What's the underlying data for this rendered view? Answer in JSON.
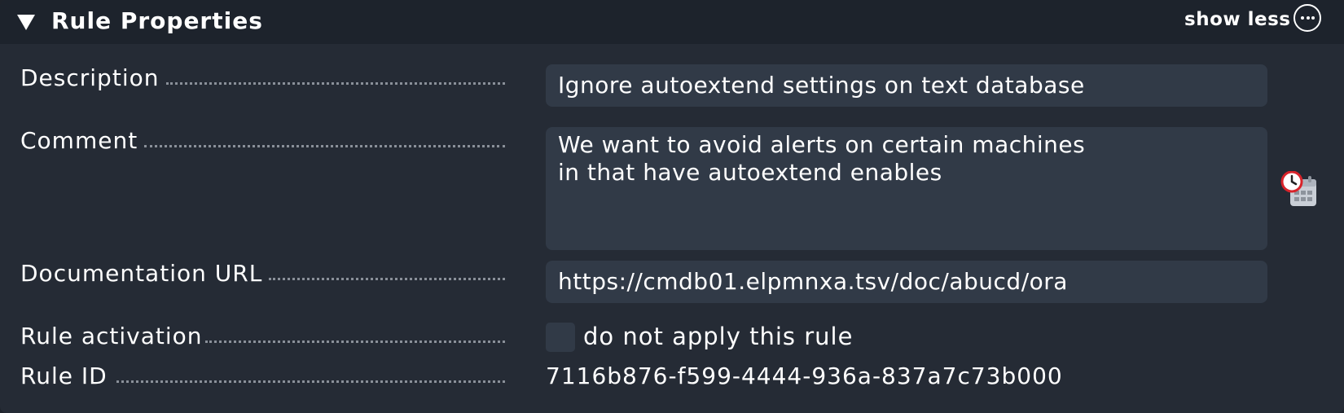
{
  "header": {
    "title": "Rule Properties",
    "show_less_label": "show less",
    "more_icon": "ellipsis-circle-icon"
  },
  "rows": {
    "description": {
      "label": "Description",
      "value": "Ignore autoextend settings on text database"
    },
    "comment": {
      "label": "Comment",
      "value": "We want to avoid alerts on certain machines\nin that have autoextend enables",
      "side_icon": "clock-calendar-icon"
    },
    "documentation_url": {
      "label": "Documentation URL",
      "value": "https://cmdb01.elpmnxa.tsv/doc/abucd/ora"
    },
    "rule_activation": {
      "label": "Rule activation",
      "checkbox_label": "do not apply this rule",
      "checked": false
    },
    "rule_id": {
      "label": "Rule ID",
      "value": "7116b876-f599-4444-936a-837a7c73b000"
    }
  },
  "colors": {
    "background": "#252b35",
    "header_background": "#1d232c",
    "field_background": "#313a47",
    "text": "#ffffff"
  }
}
